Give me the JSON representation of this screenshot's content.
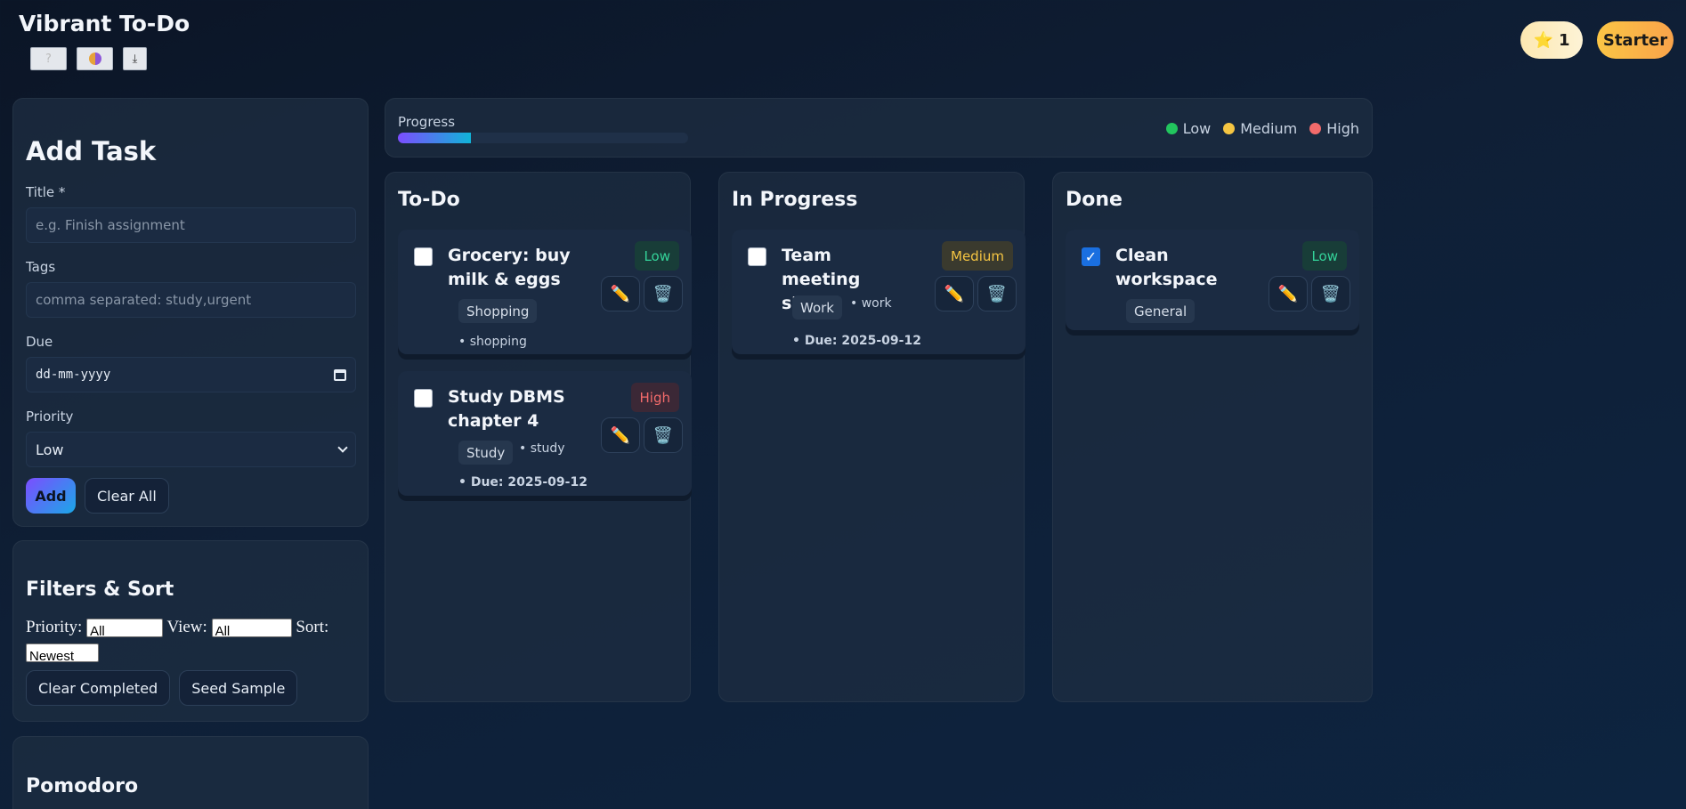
{
  "app": {
    "title": "Vibrant To-Do"
  },
  "toolbar": {
    "buttons": [
      "help-icon",
      "theme-icon",
      "download-icon"
    ],
    "help_glyph": "?",
    "download_glyph": "⤓"
  },
  "header_right": {
    "stars": "1",
    "star_glyph": "⭐",
    "level": "Starter"
  },
  "add_task": {
    "heading": "Add Task",
    "title_label": "Title *",
    "title_placeholder": "e.g. Finish assignment",
    "tags_label": "Tags",
    "tags_placeholder": "comma separated: study,urgent",
    "due_label": "Due",
    "due_placeholder": "dd-mm-yyyy",
    "priority_label": "Priority",
    "priority_value": "Low",
    "add_label": "Add",
    "clear_label": "Clear All"
  },
  "filters": {
    "heading": "Filters & Sort",
    "priority_label": "Priority:",
    "priority_value": "All",
    "view_label": "View:",
    "view_value": "All",
    "sort_label": "Sort:",
    "sort_value": "Newest",
    "clear_completed_label": "Clear Completed",
    "seed_label": "Seed Sample"
  },
  "pomodoro": {
    "heading": "Pomodoro"
  },
  "progress": {
    "label": "Progress",
    "fraction": 0.25
  },
  "legend": [
    {
      "label": "Low",
      "color": "#22c55e"
    },
    {
      "label": "Medium",
      "color": "#f5c542"
    },
    {
      "label": "High",
      "color": "#f36b6b"
    }
  ],
  "columns": [
    {
      "title": "To-Do",
      "cards": [
        {
          "title": "Grocery: buy milk & eggs",
          "priority": "Low",
          "tag": "Shopping",
          "meta": "• shopping",
          "checked": false
        },
        {
          "title": "Study DBMS chapter 4",
          "priority": "High",
          "tag": "Study",
          "meta": "• study",
          "due": "• Due: 2025-09-12",
          "checked": false
        }
      ]
    },
    {
      "title": "In Progress",
      "cards": [
        {
          "title": "Team meeting slides",
          "priority": "Medium",
          "tag": "Work",
          "meta": "• work",
          "due": "• Due: 2025-09-12",
          "checked": false
        }
      ]
    },
    {
      "title": "Done",
      "cards": [
        {
          "title": "Clean workspace",
          "priority": "Low",
          "tag": "General",
          "checked": true
        }
      ]
    }
  ],
  "icons": {
    "edit": "pencil-icon",
    "delete": "trash-icon"
  },
  "colors": {
    "accent_purple": "#7c4dff",
    "accent_cyan": "#1aa8e8",
    "bg": "#0b1526"
  }
}
